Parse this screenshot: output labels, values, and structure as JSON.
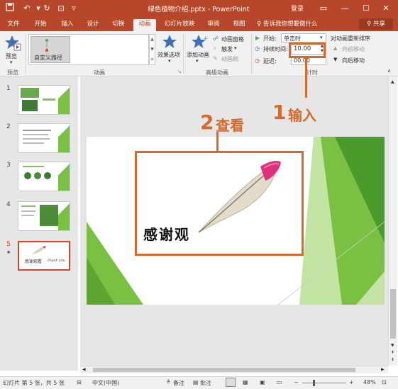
{
  "title_bar": {
    "doc_title": "绿色植物介绍.pptx - PowerPoint",
    "login": "登录"
  },
  "tabs": [
    "文件",
    "开始",
    "插入",
    "设计",
    "切换",
    "动画",
    "幻灯片放映",
    "审阅",
    "视图"
  ],
  "tell_me": "告诉我你想要做什么",
  "share": "共享",
  "ribbon": {
    "preview": {
      "label": "预览",
      "group": "预览"
    },
    "animation": {
      "item": "自定义路径",
      "group": "动画"
    },
    "effect_options": "效果选项",
    "advanced": {
      "add_animation": "添加动画",
      "pane": "动画窗格",
      "trigger": "触发",
      "painter": "动画刷",
      "group": "高级动画"
    },
    "timing": {
      "start_label": "开始:",
      "start_value": "单击时",
      "duration_label": "持续时间:",
      "duration_value": "10.00",
      "delay_label": "延迟:",
      "delay_value": "00.00",
      "reorder": "对动画重新排序",
      "move_earlier": "向前移动",
      "move_later": "向后移动",
      "group": "计时"
    }
  },
  "slides": [
    "1",
    "2",
    "3",
    "4",
    "5"
  ],
  "slide5": {
    "title_text": "感谢观",
    "thumb_text": "感谢观看",
    "thumb_sub": "thank you"
  },
  "annotations": {
    "step1_num": "1",
    "step1_text": "输入",
    "step2_num": "2",
    "step2_text": "查看"
  },
  "status_bar": {
    "slide_info": "幻灯片 第 5 张，共 5 张",
    "language": "中文(中国)",
    "notes": "备注",
    "comments": "批注",
    "zoom": "48%"
  },
  "colors": {
    "accent": "#b7472a",
    "annotation": "#d26b2c",
    "slide_green": "#7ac143"
  }
}
